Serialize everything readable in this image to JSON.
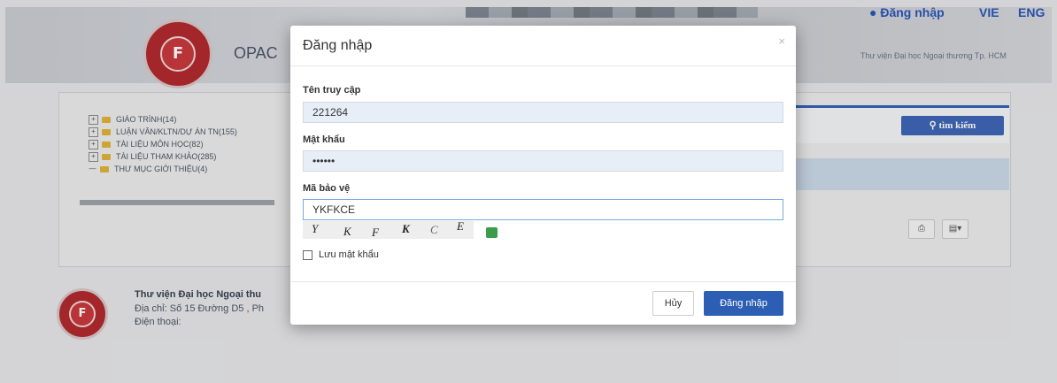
{
  "header": {
    "opac_label": "OPAC",
    "login_link": "Đăng nhập",
    "lang_vie": "VIE",
    "lang_eng": "ENG",
    "library_name_short": "Thư viện Đại học Ngoại thương Tp. HCM"
  },
  "tree": {
    "items": [
      {
        "label": "GIÁO TRÌNH(14)"
      },
      {
        "label": "LUẬN VĂN/KLTN/DỰ ÁN TN(155)"
      },
      {
        "label": "TÀI LIỆU MÔN HỌC(82)"
      },
      {
        "label": "TÀI LIỆU THAM KHẢO(285)"
      },
      {
        "label": "THƯ MỤC GIỚI THIỆU(4)"
      }
    ]
  },
  "search": {
    "button_label": "tìm kiếm"
  },
  "footer": {
    "title": "Thư viện Đại học Ngoại thu",
    "address": "Địa chỉ: Số 15 Đường D5 , Ph",
    "phone": "Điện thoại:"
  },
  "modal": {
    "title": "Đăng nhập",
    "close": "×",
    "username_label": "Tên truy cập",
    "username_value": "221264",
    "password_label": "Mật khẩu",
    "password_value": "••••••",
    "captcha_label": "Mã bảo vệ",
    "captcha_value": "YKFKCE",
    "captcha_chars": [
      "Y",
      "K",
      "F",
      "K",
      "C",
      "E"
    ],
    "remember_label": "Lưu mật khẩu",
    "cancel_label": "Hủy",
    "login_label": "Đăng nhập"
  },
  "colors": {
    "primary": "#2c5fb3",
    "logo_red": "#b02a2e"
  }
}
